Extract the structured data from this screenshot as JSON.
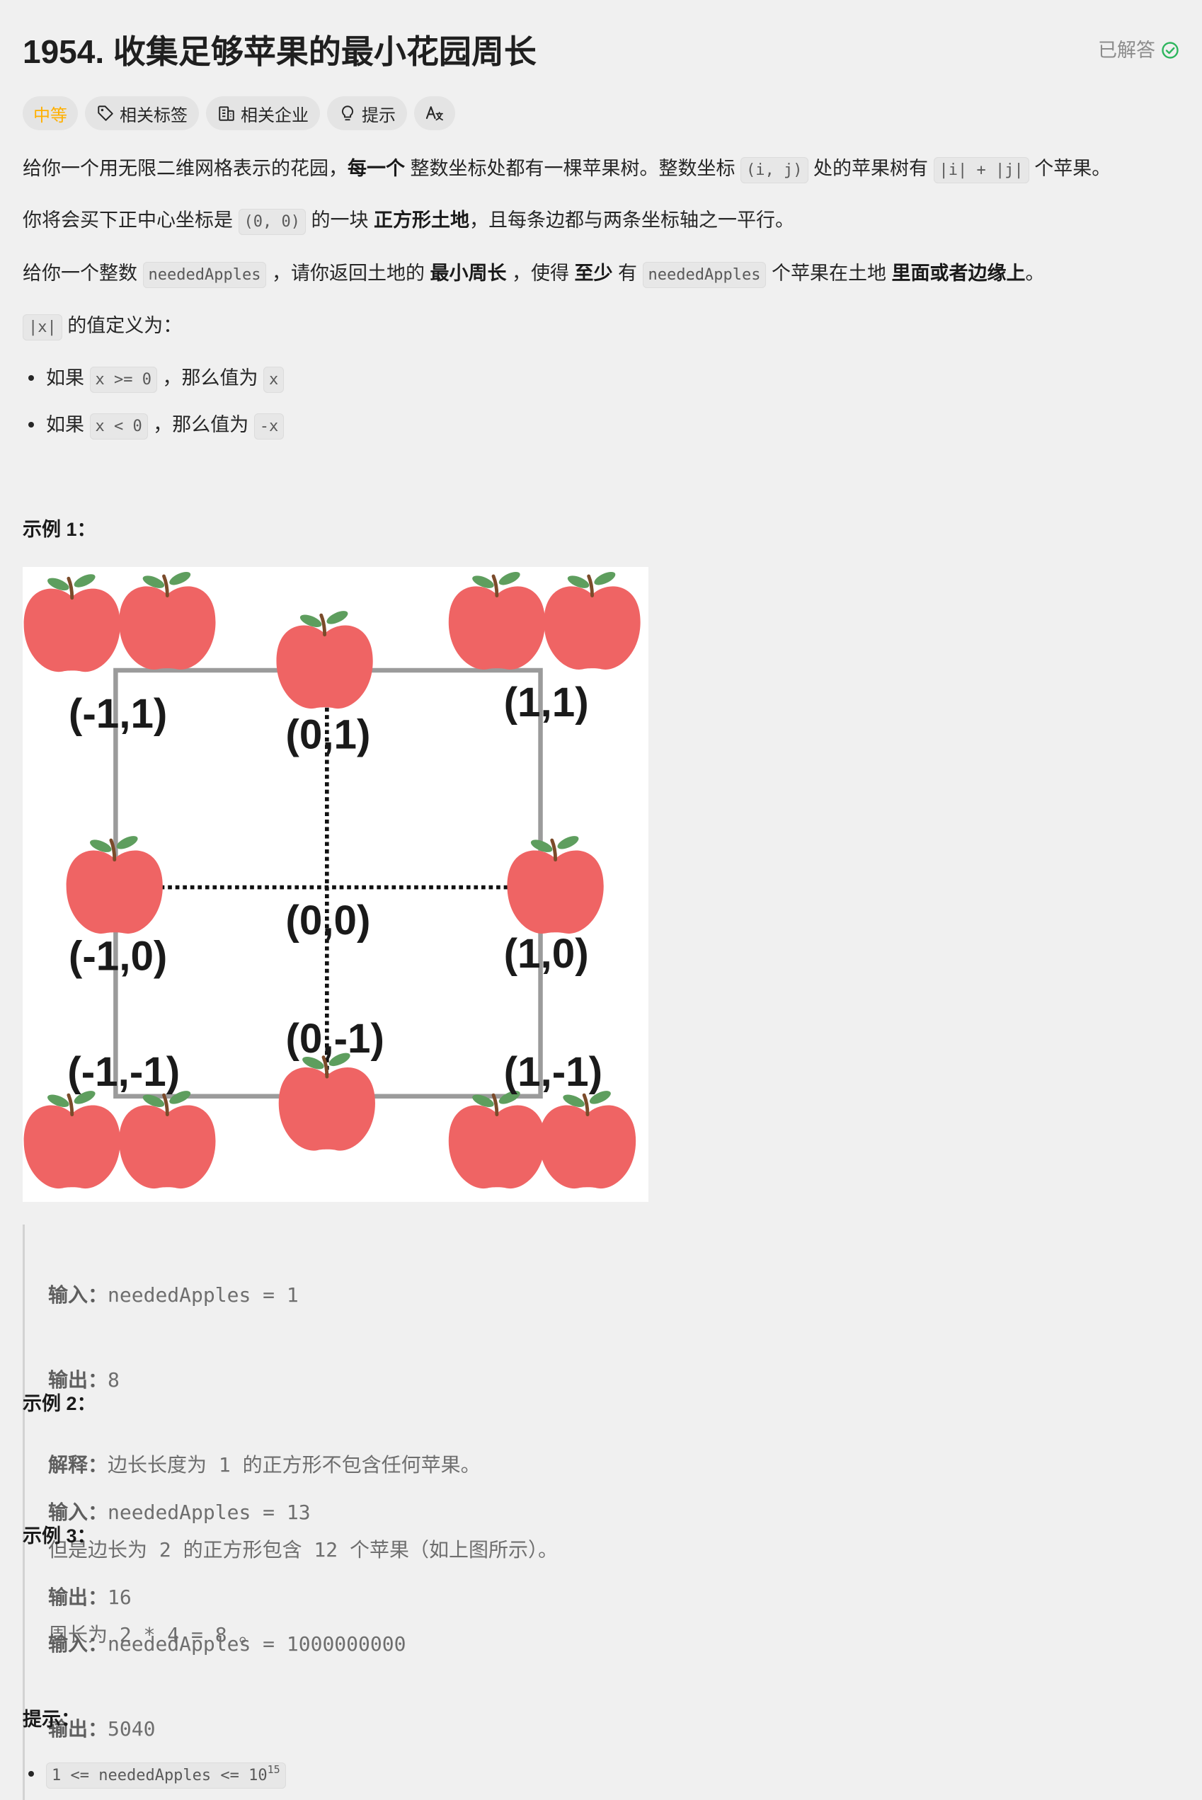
{
  "header": {
    "title": "1954. 收集足够苹果的最小花园周长",
    "status": "已解答"
  },
  "tags": {
    "difficulty": "中等",
    "related_tags": "相关标签",
    "related_companies": "相关企业",
    "hint": "提示"
  },
  "icons": {
    "status": "check-circle-icon",
    "related_tags": "tag-icon",
    "related_companies": "building-icon",
    "hint": "lightbulb-icon",
    "translate": "translate-icon"
  },
  "colors": {
    "difficulty": "#ffb000",
    "solved": "#2db55d",
    "apple": "#ef6464",
    "leaf": "#5e9e5e"
  },
  "description": {
    "p1": [
      "给你一个用无限二维网格表示的花园，",
      "每一个",
      " 整数坐标处都有一棵苹果树。整数坐标 ",
      "(i, j)",
      " 处的苹果树有 ",
      "|i| + |j|",
      " 个苹果。"
    ],
    "p2": [
      "你将会买下正中心坐标是 ",
      "(0, 0)",
      " 的一块 ",
      "正方形土地",
      "，且每条边都与两条坐标轴之一平行。"
    ],
    "p3": [
      "给你一个整数 ",
      "neededApples",
      " ，请你返回土地的 ",
      "最小周长",
      " ，使得 ",
      "至少",
      " 有 ",
      "neededApples",
      " 个苹果在土地 ",
      "里面或者边缘上",
      "。"
    ],
    "p4": [
      "|x|",
      " 的值定义为："
    ],
    "bullets": [
      [
        "如果 ",
        "x >= 0",
        " ，那么值为 ",
        "x"
      ],
      [
        "如果 ",
        "x < 0",
        " ，那么值为 ",
        "-x"
      ]
    ]
  },
  "figure": {
    "labels": [
      "(-1,1)",
      "(0,1)",
      "(1,1)",
      "(-1,0)",
      "(0,0)",
      "(1,0)",
      "(-1,-1)",
      "(0,-1)",
      "(1,-1)"
    ]
  },
  "examples": [
    {
      "heading": "示例 1：",
      "lines": [
        {
          "label": "输入：",
          "text": "neededApples = 1"
        },
        {
          "label": "输出：",
          "text": "8"
        },
        {
          "label": "解释：",
          "text": "边长长度为 1 的正方形不包含任何苹果。"
        },
        {
          "text": "但是边长为 2 的正方形包含 12 个苹果（如上图所示）。"
        },
        {
          "text": "周长为 2 * 4 = 8 。"
        }
      ]
    },
    {
      "heading": "示例 2：",
      "lines": [
        {
          "label": "输入：",
          "text": "neededApples = 13"
        },
        {
          "label": "输出：",
          "text": "16"
        }
      ]
    },
    {
      "heading": "示例 3：",
      "lines": [
        {
          "label": "输入：",
          "text": "neededApples = 1000000000"
        },
        {
          "label": "输出：",
          "text": "5040"
        }
      ]
    }
  ],
  "constraints": {
    "heading": "提示：",
    "items": [
      {
        "text": "1 <= neededApples <= 10",
        "sup": "15"
      }
    ]
  }
}
